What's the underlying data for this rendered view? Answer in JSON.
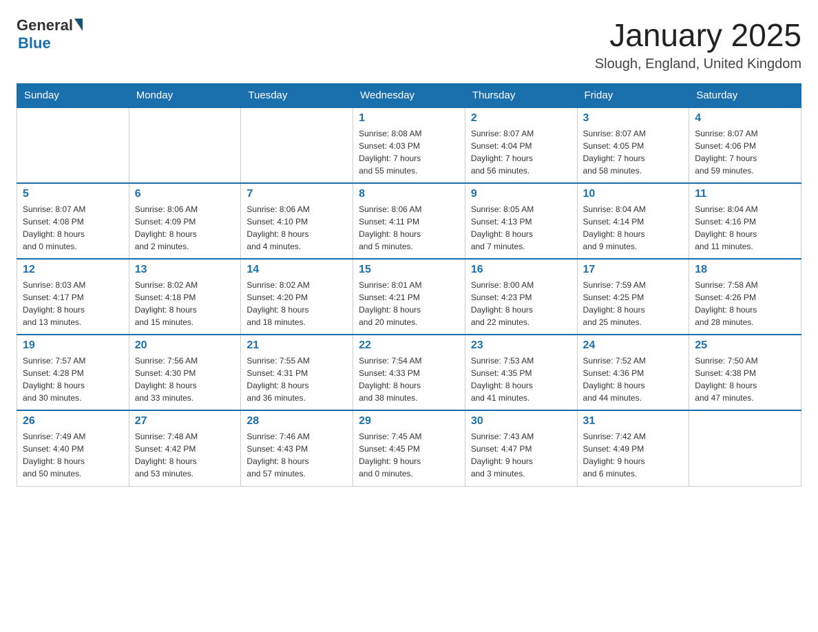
{
  "header": {
    "logo_general": "General",
    "logo_blue": "Blue",
    "title": "January 2025",
    "location": "Slough, England, United Kingdom"
  },
  "days_of_week": [
    "Sunday",
    "Monday",
    "Tuesday",
    "Wednesday",
    "Thursday",
    "Friday",
    "Saturday"
  ],
  "weeks": [
    {
      "days": [
        {
          "num": "",
          "info": ""
        },
        {
          "num": "",
          "info": ""
        },
        {
          "num": "",
          "info": ""
        },
        {
          "num": "1",
          "info": "Sunrise: 8:08 AM\nSunset: 4:03 PM\nDaylight: 7 hours\nand 55 minutes."
        },
        {
          "num": "2",
          "info": "Sunrise: 8:07 AM\nSunset: 4:04 PM\nDaylight: 7 hours\nand 56 minutes."
        },
        {
          "num": "3",
          "info": "Sunrise: 8:07 AM\nSunset: 4:05 PM\nDaylight: 7 hours\nand 58 minutes."
        },
        {
          "num": "4",
          "info": "Sunrise: 8:07 AM\nSunset: 4:06 PM\nDaylight: 7 hours\nand 59 minutes."
        }
      ]
    },
    {
      "days": [
        {
          "num": "5",
          "info": "Sunrise: 8:07 AM\nSunset: 4:08 PM\nDaylight: 8 hours\nand 0 minutes."
        },
        {
          "num": "6",
          "info": "Sunrise: 8:06 AM\nSunset: 4:09 PM\nDaylight: 8 hours\nand 2 minutes."
        },
        {
          "num": "7",
          "info": "Sunrise: 8:06 AM\nSunset: 4:10 PM\nDaylight: 8 hours\nand 4 minutes."
        },
        {
          "num": "8",
          "info": "Sunrise: 8:06 AM\nSunset: 4:11 PM\nDaylight: 8 hours\nand 5 minutes."
        },
        {
          "num": "9",
          "info": "Sunrise: 8:05 AM\nSunset: 4:13 PM\nDaylight: 8 hours\nand 7 minutes."
        },
        {
          "num": "10",
          "info": "Sunrise: 8:04 AM\nSunset: 4:14 PM\nDaylight: 8 hours\nand 9 minutes."
        },
        {
          "num": "11",
          "info": "Sunrise: 8:04 AM\nSunset: 4:16 PM\nDaylight: 8 hours\nand 11 minutes."
        }
      ]
    },
    {
      "days": [
        {
          "num": "12",
          "info": "Sunrise: 8:03 AM\nSunset: 4:17 PM\nDaylight: 8 hours\nand 13 minutes."
        },
        {
          "num": "13",
          "info": "Sunrise: 8:02 AM\nSunset: 4:18 PM\nDaylight: 8 hours\nand 15 minutes."
        },
        {
          "num": "14",
          "info": "Sunrise: 8:02 AM\nSunset: 4:20 PM\nDaylight: 8 hours\nand 18 minutes."
        },
        {
          "num": "15",
          "info": "Sunrise: 8:01 AM\nSunset: 4:21 PM\nDaylight: 8 hours\nand 20 minutes."
        },
        {
          "num": "16",
          "info": "Sunrise: 8:00 AM\nSunset: 4:23 PM\nDaylight: 8 hours\nand 22 minutes."
        },
        {
          "num": "17",
          "info": "Sunrise: 7:59 AM\nSunset: 4:25 PM\nDaylight: 8 hours\nand 25 minutes."
        },
        {
          "num": "18",
          "info": "Sunrise: 7:58 AM\nSunset: 4:26 PM\nDaylight: 8 hours\nand 28 minutes."
        }
      ]
    },
    {
      "days": [
        {
          "num": "19",
          "info": "Sunrise: 7:57 AM\nSunset: 4:28 PM\nDaylight: 8 hours\nand 30 minutes."
        },
        {
          "num": "20",
          "info": "Sunrise: 7:56 AM\nSunset: 4:30 PM\nDaylight: 8 hours\nand 33 minutes."
        },
        {
          "num": "21",
          "info": "Sunrise: 7:55 AM\nSunset: 4:31 PM\nDaylight: 8 hours\nand 36 minutes."
        },
        {
          "num": "22",
          "info": "Sunrise: 7:54 AM\nSunset: 4:33 PM\nDaylight: 8 hours\nand 38 minutes."
        },
        {
          "num": "23",
          "info": "Sunrise: 7:53 AM\nSunset: 4:35 PM\nDaylight: 8 hours\nand 41 minutes."
        },
        {
          "num": "24",
          "info": "Sunrise: 7:52 AM\nSunset: 4:36 PM\nDaylight: 8 hours\nand 44 minutes."
        },
        {
          "num": "25",
          "info": "Sunrise: 7:50 AM\nSunset: 4:38 PM\nDaylight: 8 hours\nand 47 minutes."
        }
      ]
    },
    {
      "days": [
        {
          "num": "26",
          "info": "Sunrise: 7:49 AM\nSunset: 4:40 PM\nDaylight: 8 hours\nand 50 minutes."
        },
        {
          "num": "27",
          "info": "Sunrise: 7:48 AM\nSunset: 4:42 PM\nDaylight: 8 hours\nand 53 minutes."
        },
        {
          "num": "28",
          "info": "Sunrise: 7:46 AM\nSunset: 4:43 PM\nDaylight: 8 hours\nand 57 minutes."
        },
        {
          "num": "29",
          "info": "Sunrise: 7:45 AM\nSunset: 4:45 PM\nDaylight: 9 hours\nand 0 minutes."
        },
        {
          "num": "30",
          "info": "Sunrise: 7:43 AM\nSunset: 4:47 PM\nDaylight: 9 hours\nand 3 minutes."
        },
        {
          "num": "31",
          "info": "Sunrise: 7:42 AM\nSunset: 4:49 PM\nDaylight: 9 hours\nand 6 minutes."
        },
        {
          "num": "",
          "info": ""
        }
      ]
    }
  ]
}
